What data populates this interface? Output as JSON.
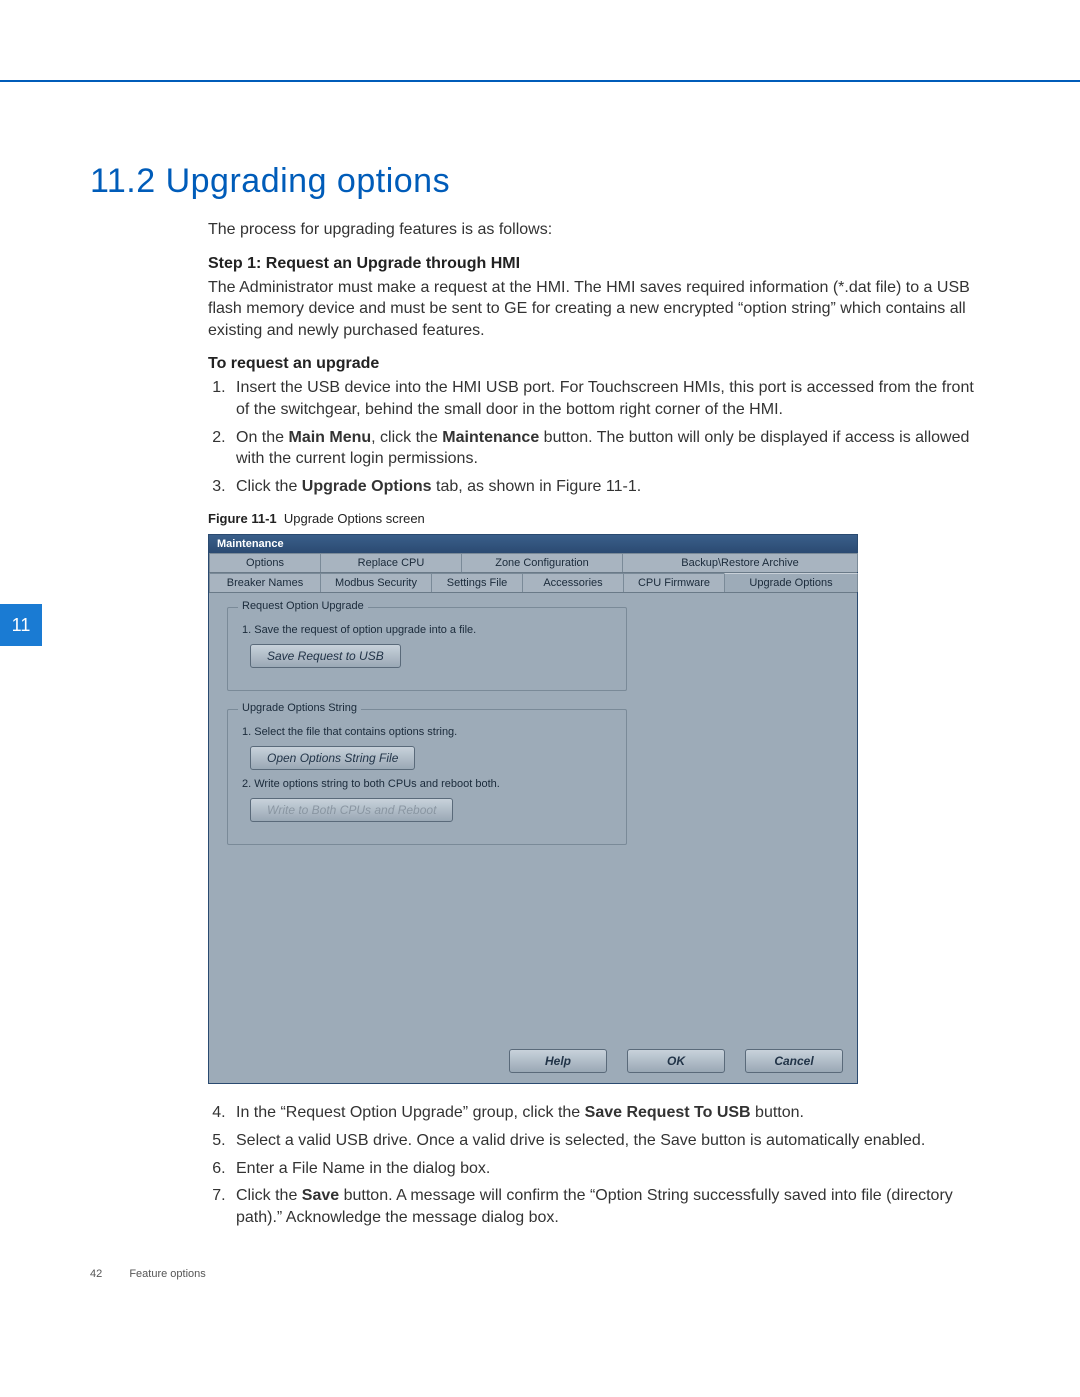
{
  "chapter_tab": "11",
  "section_title": "11.2 Upgrading options",
  "intro": "The process for upgrading features is as follows:",
  "step1_heading": "Step 1: Request an Upgrade through HMI",
  "step1_text": "The Administrator must make a request at the HMI. The HMI saves required information (*.dat file) to a USB flash memory device and must be sent to GE for creating a new encrypted “option string” which contains all existing and newly purchased features.",
  "request_heading": "To request an upgrade",
  "steps_a": [
    "Insert the USB device into the HMI USB port. For Touchscreen HMIs, this port is accessed from the front of the switchgear, behind the small door in the bottom right corner of the HMI.",
    "On the Main Menu, click the Maintenance button. The button will only be displayed if access is allowed with the current login permissions.",
    "Click the Upgrade Options tab, as shown in Figure 11-1."
  ],
  "figure_caption_label": "Figure 11-1",
  "figure_caption_text": "Upgrade Options screen",
  "hmi": {
    "title": "Maintenance",
    "tabs_row1": [
      "Options",
      "Replace CPU",
      "Zone Configuration",
      "Backup\\Restore Archive"
    ],
    "tabs_row2": [
      "Breaker Names",
      "Modbus Security",
      "Settings File",
      "Accessories",
      "CPU Firmware",
      "Upgrade Options"
    ],
    "group1": {
      "legend": "Request Option Upgrade",
      "text1": "1. Save the request of option upgrade into a file.",
      "button1": "Save Request to USB"
    },
    "group2": {
      "legend": "Upgrade Options String",
      "text1": "1. Select the file that contains options string.",
      "button1": "Open Options String File",
      "text2": "2. Write options string to both CPUs and reboot both.",
      "button2": "Write to Both CPUs and Reboot"
    },
    "footer": {
      "help": "Help",
      "ok": "OK",
      "cancel": "Cancel"
    }
  },
  "steps_b": [
    "In the “Request Option Upgrade” group, click the Save Request To USB button.",
    "Select a valid USB drive. Once a valid drive is selected, the Save button is automatically enabled.",
    "Enter a File Name in the dialog box.",
    "Click the Save button. A message will confirm the “Option String successfully saved into file (directory path).” Acknowledge the message dialog box."
  ],
  "footer": {
    "page_number": "42",
    "section": "Feature options"
  }
}
